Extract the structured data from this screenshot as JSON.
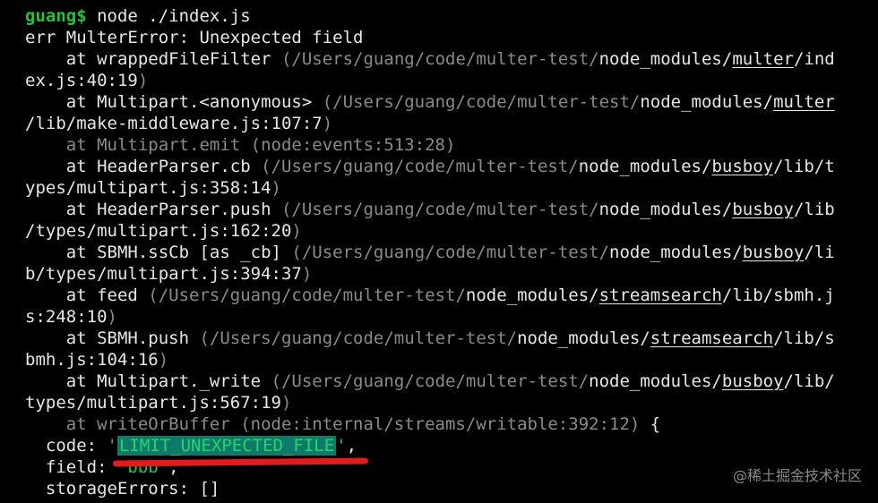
{
  "terminal": {
    "prompt": "guang$",
    "command": " node ./index.js",
    "error_header": "err MulterError: Unexpected field",
    "stack": {
      "l1_at": "    at wrappedFileFilter ",
      "l1_p1": "(/Users/guang/code/multer-test/",
      "l1_nm": "node_modules/",
      "l1_mod": "multer",
      "l1_tail": "/ind",
      "l2": "ex.js:40:19",
      "l2_close": ")",
      "l3_at": "    at Multipart.<anonymous> ",
      "l3_p1": "(/Users/guang/code/multer-test/",
      "l3_nm": "node_modules/",
      "l3_mod": "multer",
      "l4": "/lib/make-middleware.js:107:7",
      "l4_close": ")",
      "l5": "    at Multipart.emit (node:events:513:28)",
      "l6_at": "    at HeaderParser.cb ",
      "l6_p1": "(/Users/guang/code/multer-test/",
      "l6_nm": "node_modules/",
      "l6_mod": "busboy",
      "l6_tail": "/lib/t",
      "l7": "ypes/multipart.js:358:14",
      "l7_close": ")",
      "l8_at": "    at HeaderParser.push ",
      "l8_p1": "(/Users/guang/code/multer-test/",
      "l8_nm": "node_modules/",
      "l8_mod": "busboy",
      "l8_tail": "/lib",
      "l9": "/types/multipart.js:162:20",
      "l9_close": ")",
      "l10_at": "    at SBMH.ssCb [as _cb] ",
      "l10_p1": "(/Users/guang/code/multer-test/",
      "l10_nm": "node_modules/",
      "l10_mod": "busboy",
      "l10_tail": "/li",
      "l11": "b/types/multipart.js:394:37",
      "l11_close": ")",
      "l12_at": "    at feed ",
      "l12_p1": "(/Users/guang/code/multer-test/",
      "l12_nm": "node_modules/",
      "l12_mod": "streamsearch",
      "l12_tail": "/lib/sbmh.j",
      "l13": "s:248:10",
      "l13_close": ")",
      "l14_at": "    at SBMH.push ",
      "l14_p1": "(/Users/guang/code/multer-test/",
      "l14_nm": "node_modules/",
      "l14_mod": "streamsearch",
      "l14_tail": "/lib/s",
      "l15": "bmh.js:104:16",
      "l15_close": ")",
      "l16_at": "    at Multipart._write ",
      "l16_p1": "(/Users/guang/code/multer-test/",
      "l16_nm": "node_modules/",
      "l16_mod": "busboy",
      "l16_tail": "/lib/",
      "l17": "types/multipart.js:567:19",
      "l17_close": ")",
      "l18": "    at writeOrBuffer (node:internal/streams/writable:392:12)",
      "l18_brace": " {"
    },
    "code_key": "  code: ",
    "code_quote_open": "'",
    "code_value": "LIMIT_UNEXPECTED_FILE",
    "code_quote_close": "'",
    "code_comma": ",",
    "field_key": "  field: ",
    "field_value": "'bbb'",
    "field_comma": ",",
    "storage_line": "  storageErrors: []"
  },
  "watermark": "@稀土掘金技术社区",
  "colors": {
    "background": "#000000",
    "prompt": "#21c437",
    "string": "#25c24a",
    "highlight": "#0f7a6a",
    "annotation": "#e21b1b"
  }
}
